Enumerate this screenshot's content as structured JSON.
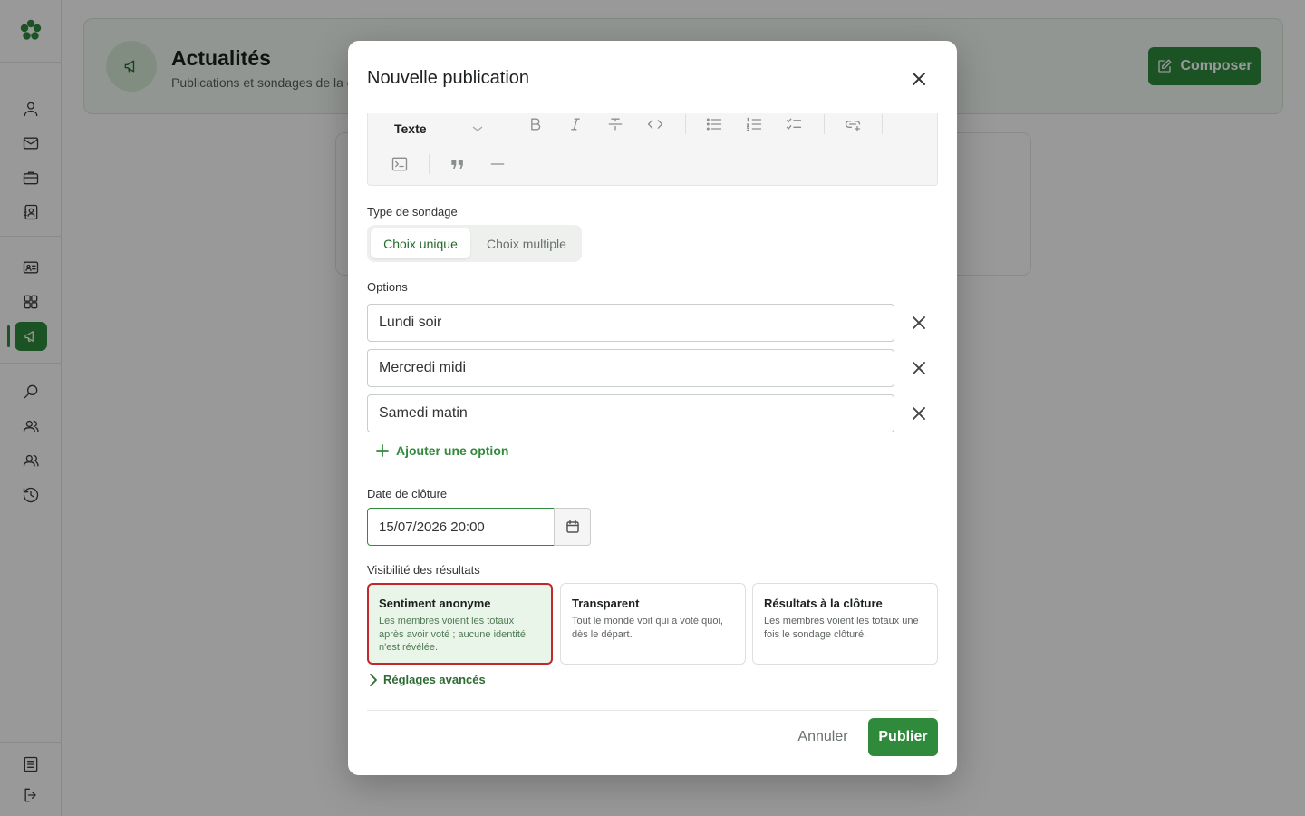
{
  "page": {
    "title": "Actualités",
    "subtitle": "Publications et sondages de la communauté",
    "compose_label": "Composer"
  },
  "sidebar": {
    "items": [
      {
        "name": "profile",
        "icon": "user-icon"
      },
      {
        "name": "messages",
        "icon": "mail-icon"
      },
      {
        "name": "work",
        "icon": "briefcase-icon"
      },
      {
        "name": "contacts",
        "icon": "contact-book-icon"
      },
      {
        "name": "id-card",
        "icon": "id-card-icon"
      },
      {
        "name": "apps",
        "icon": "grid-icon"
      },
      {
        "name": "news",
        "icon": "megaphone-icon",
        "active": true
      },
      {
        "name": "search",
        "icon": "search-icon"
      },
      {
        "name": "groups",
        "icon": "users-icon"
      },
      {
        "name": "members",
        "icon": "users-icon"
      },
      {
        "name": "history",
        "icon": "history-icon"
      },
      {
        "name": "notes",
        "icon": "document-icon"
      },
      {
        "name": "logout",
        "icon": "logout-icon"
      }
    ]
  },
  "modal": {
    "title": "Nouvelle publication",
    "editor": {
      "block_type": "Texte",
      "tools": [
        "bold-icon",
        "italic-icon",
        "strikethrough-icon",
        "code-icon",
        "bullet-list-icon",
        "ordered-list-icon",
        "checklist-icon",
        "link-icon",
        "code-block-icon",
        "quote-icon",
        "horizontal-rule-icon"
      ]
    },
    "poll_type": {
      "label": "Type de sondage",
      "single": "Choix unique",
      "multiple": "Choix multiple",
      "selected": "Choix unique"
    },
    "options": {
      "label": "Options",
      "values": [
        "Lundi soir",
        "Mercredi midi",
        "Samedi matin"
      ],
      "add_label": "Ajouter une option"
    },
    "closing_date": {
      "label": "Date de clôture",
      "value": "15/07/2026 20:00"
    },
    "visibility": {
      "label": "Visibilité des résultats",
      "cards": [
        {
          "title": "Sentiment anonyme",
          "desc": "Les membres voient les totaux après avoir voté ; aucune identité n'est révélée.",
          "selected": true
        },
        {
          "title": "Transparent",
          "desc": "Tout le monde voit qui a voté quoi, dès le départ.",
          "selected": false
        },
        {
          "title": "Résultats à la clôture",
          "desc": "Les membres voient les totaux une fois le sondage clôturé.",
          "selected": false
        }
      ]
    },
    "advanced_label": "Réglages avancés",
    "cancel_label": "Annuler",
    "publish_label": "Publier"
  },
  "colors": {
    "accent": "#2f8a3c",
    "selected_border": "#c0282b",
    "selected_bg": "#e9f5e9"
  }
}
